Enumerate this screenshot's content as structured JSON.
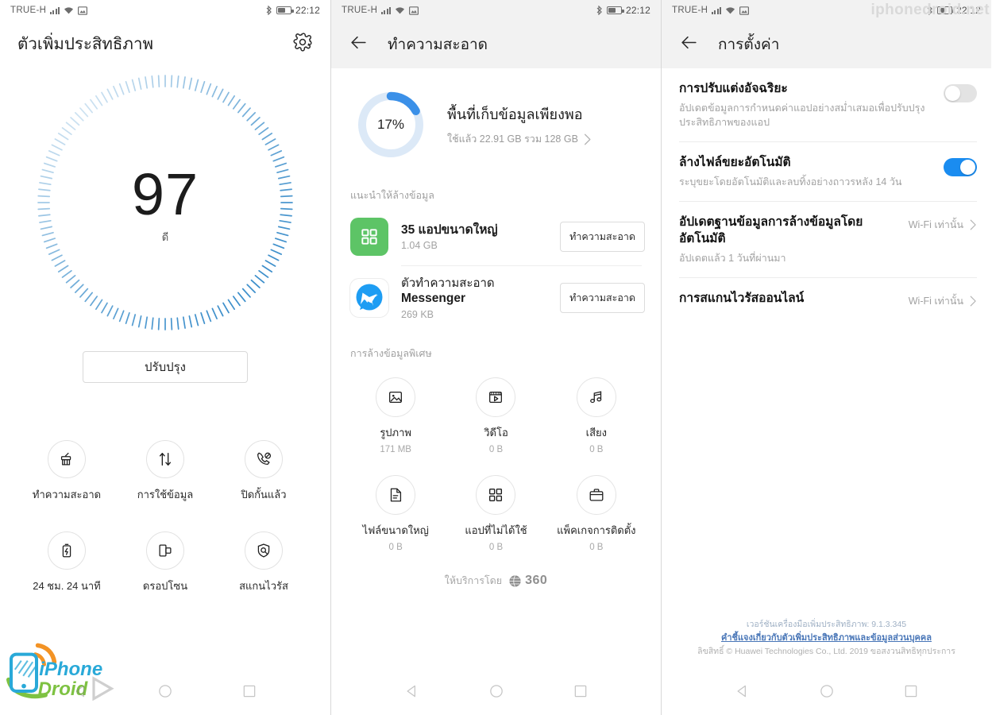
{
  "statusbar": {
    "carrier": "TRUE-H",
    "time": "22:12",
    "icons": [
      "signal-bars-icon",
      "wifi-icon",
      "sim-icon",
      "bluetooth-icon",
      "battery-icon"
    ]
  },
  "panel1": {
    "title": "ตัวเพิ่มประสิทธิภาพ",
    "settings_icon": "gear-icon",
    "score": "97",
    "score_label": "ดี",
    "optimize_button": "ปรับปรุง",
    "tiles": [
      {
        "icon": "broom-icon",
        "label": "ทำความสะอาด"
      },
      {
        "icon": "data-usage-icon",
        "label": "การใช้ข้อมูล"
      },
      {
        "icon": "call-block-icon",
        "label": "ปิดกั้นแล้ว"
      },
      {
        "icon": "battery-bolt-icon",
        "label": "24 ชม. 24 นาที"
      },
      {
        "icon": "dropzone-icon",
        "label": "ดรอปโซน"
      },
      {
        "icon": "virus-scan-icon",
        "label": "สแกนไวรัส"
      }
    ]
  },
  "panel2": {
    "title": "ทำความสะอาด",
    "back_icon": "back-arrow-icon",
    "storage": {
      "percent": "17%",
      "percent_value": 17,
      "title": "พื้นที่เก็บข้อมูลเพียงพอ",
      "subtitle": "ใช้แล้ว 22.91 GB รวม 128 GB",
      "chevron": "chevron-right-icon",
      "ring_color": "#3b90e8",
      "ring_track": "#dce9f7"
    },
    "recommend_label": "แนะนำให้ล้างข้อมูล",
    "apps": [
      {
        "icon": "app-grid-icon",
        "icon_color": "#5dc466",
        "name": "35 แอปขนาดใหญ่",
        "name2": "",
        "size": "1.04 GB",
        "button": "ทำความสะอาด"
      },
      {
        "icon": "messenger-icon",
        "icon_color": "#1e9df3",
        "name": "ตัวทำความสะอาด",
        "name2": "Messenger",
        "size": "269 KB",
        "button": "ทำความสะอาด"
      }
    ],
    "special_label": "การล้างข้อมูลพิเศษ",
    "special_items": [
      {
        "icon": "image-icon",
        "label": "รูปภาพ",
        "size": "171 MB"
      },
      {
        "icon": "video-icon",
        "label": "วิดีโอ",
        "size": "0 B"
      },
      {
        "icon": "audio-icon",
        "label": "เสียง",
        "size": "0 B"
      },
      {
        "icon": "document-icon",
        "label": "ไฟล์ขนาดใหญ่",
        "size": "0 B"
      },
      {
        "icon": "apps-icon",
        "label": "แอปที่ไม่ได้ใช้",
        "size": "0 B"
      },
      {
        "icon": "briefcase-icon",
        "label": "แพ็คเกจการติดตั้ง",
        "size": "0 B"
      }
    ],
    "powered_by": "ให้บริการโดย",
    "powered_brand": "360",
    "powered_icon": "globe-360-icon"
  },
  "panel3": {
    "title": "การตั้งค่า",
    "back_icon": "back-arrow-icon",
    "rows": [
      {
        "title": "การปรับแต่งอัจฉริยะ",
        "desc": "อัปเดตข้อมูลการกำหนดค่าแอปอย่างสม่ำเสมอเพื่อปรับปรุงประสิทธิภาพของแอป",
        "control": "toggle",
        "toggle_on": false,
        "value": ""
      },
      {
        "title": "ล้างไฟล์ขยะอัตโนมัติ",
        "desc": "ระบุขยะโดยอัตโนมัติและลบทิ้งอย่างถาวรหลัง 14 วัน",
        "control": "toggle",
        "toggle_on": true,
        "value": ""
      },
      {
        "title": "อัปเดตฐานข้อมูลการล้างข้อมูลโดยอัตโนมัติ",
        "desc": "อัปเดตแล้ว 1 วันที่ผ่านมา",
        "control": "chevron",
        "toggle_on": false,
        "value": "Wi-Fi เท่านั้น"
      },
      {
        "title": "การสแกนไวรัสออนไลน์",
        "desc": "",
        "control": "chevron",
        "toggle_on": false,
        "value": "Wi-Fi เท่านั้น"
      }
    ],
    "footer": {
      "version": "เวอร์ชันเครื่องมือเพิ่มประสิทธิภาพ: 9.1.3.345",
      "link": "คำชี้แจงเกี่ยวกับตัวเพิ่มประสิทธิภาพและข้อมูลส่วนบุคคล",
      "copyright": "ลิขสิทธิ์ © Huawei Technologies Co., Ltd. 2019 ขอสงวนสิทธิทุกประการ"
    }
  },
  "navbar": {
    "back": "nav-back-icon",
    "home": "nav-home-icon",
    "recents": "nav-recents-icon"
  },
  "watermarks": {
    "brand_top": "iphonedroid.net",
    "logo_line1": "iPhone",
    "logo_line2": "Droid"
  },
  "colors": {
    "accent_blue": "#1a8cf0",
    "ring_blue": "#3b90e8",
    "green": "#5dc466",
    "link_blue": "#4a77b8"
  }
}
